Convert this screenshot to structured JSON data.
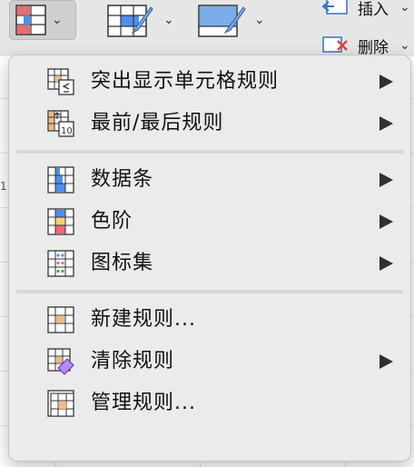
{
  "toolbar": {
    "buttons": [
      {
        "name": "conditional-format",
        "caret": "⌄"
      },
      {
        "name": "format-as-table",
        "caret": "⌄"
      },
      {
        "name": "cell-styles",
        "caret": "⌄"
      }
    ],
    "insert_label": "插入",
    "delete_label": "删除",
    "side_caret": "⌄"
  },
  "sheet_fragment": "1",
  "menu": {
    "groups": [
      [
        {
          "label": "突出显示单元格规则",
          "icon": "highlight-cells-icon",
          "submenu": true
        },
        {
          "label": "最前/最后规则",
          "icon": "top-bottom-icon",
          "submenu": true
        }
      ],
      [
        {
          "label": "数据条",
          "icon": "data-bars-icon",
          "submenu": true
        },
        {
          "label": "色阶",
          "icon": "color-scales-icon",
          "submenu": true
        },
        {
          "label": "图标集",
          "icon": "icon-sets-icon",
          "submenu": true
        }
      ],
      [
        {
          "label": "新建规则...",
          "icon": "new-rule-icon",
          "submenu": false
        },
        {
          "label": "清除规则",
          "icon": "clear-rules-icon",
          "submenu": true
        },
        {
          "label": "管理规则...",
          "icon": "manage-rules-icon",
          "submenu": false
        }
      ]
    ]
  },
  "colors": {
    "accent_blue": "#4f8ff0",
    "accent_red": "#ec6a73",
    "accent_orange": "#f6b97a",
    "accent_purple": "#b28cf0",
    "menu_bg": "#ebebeb"
  }
}
